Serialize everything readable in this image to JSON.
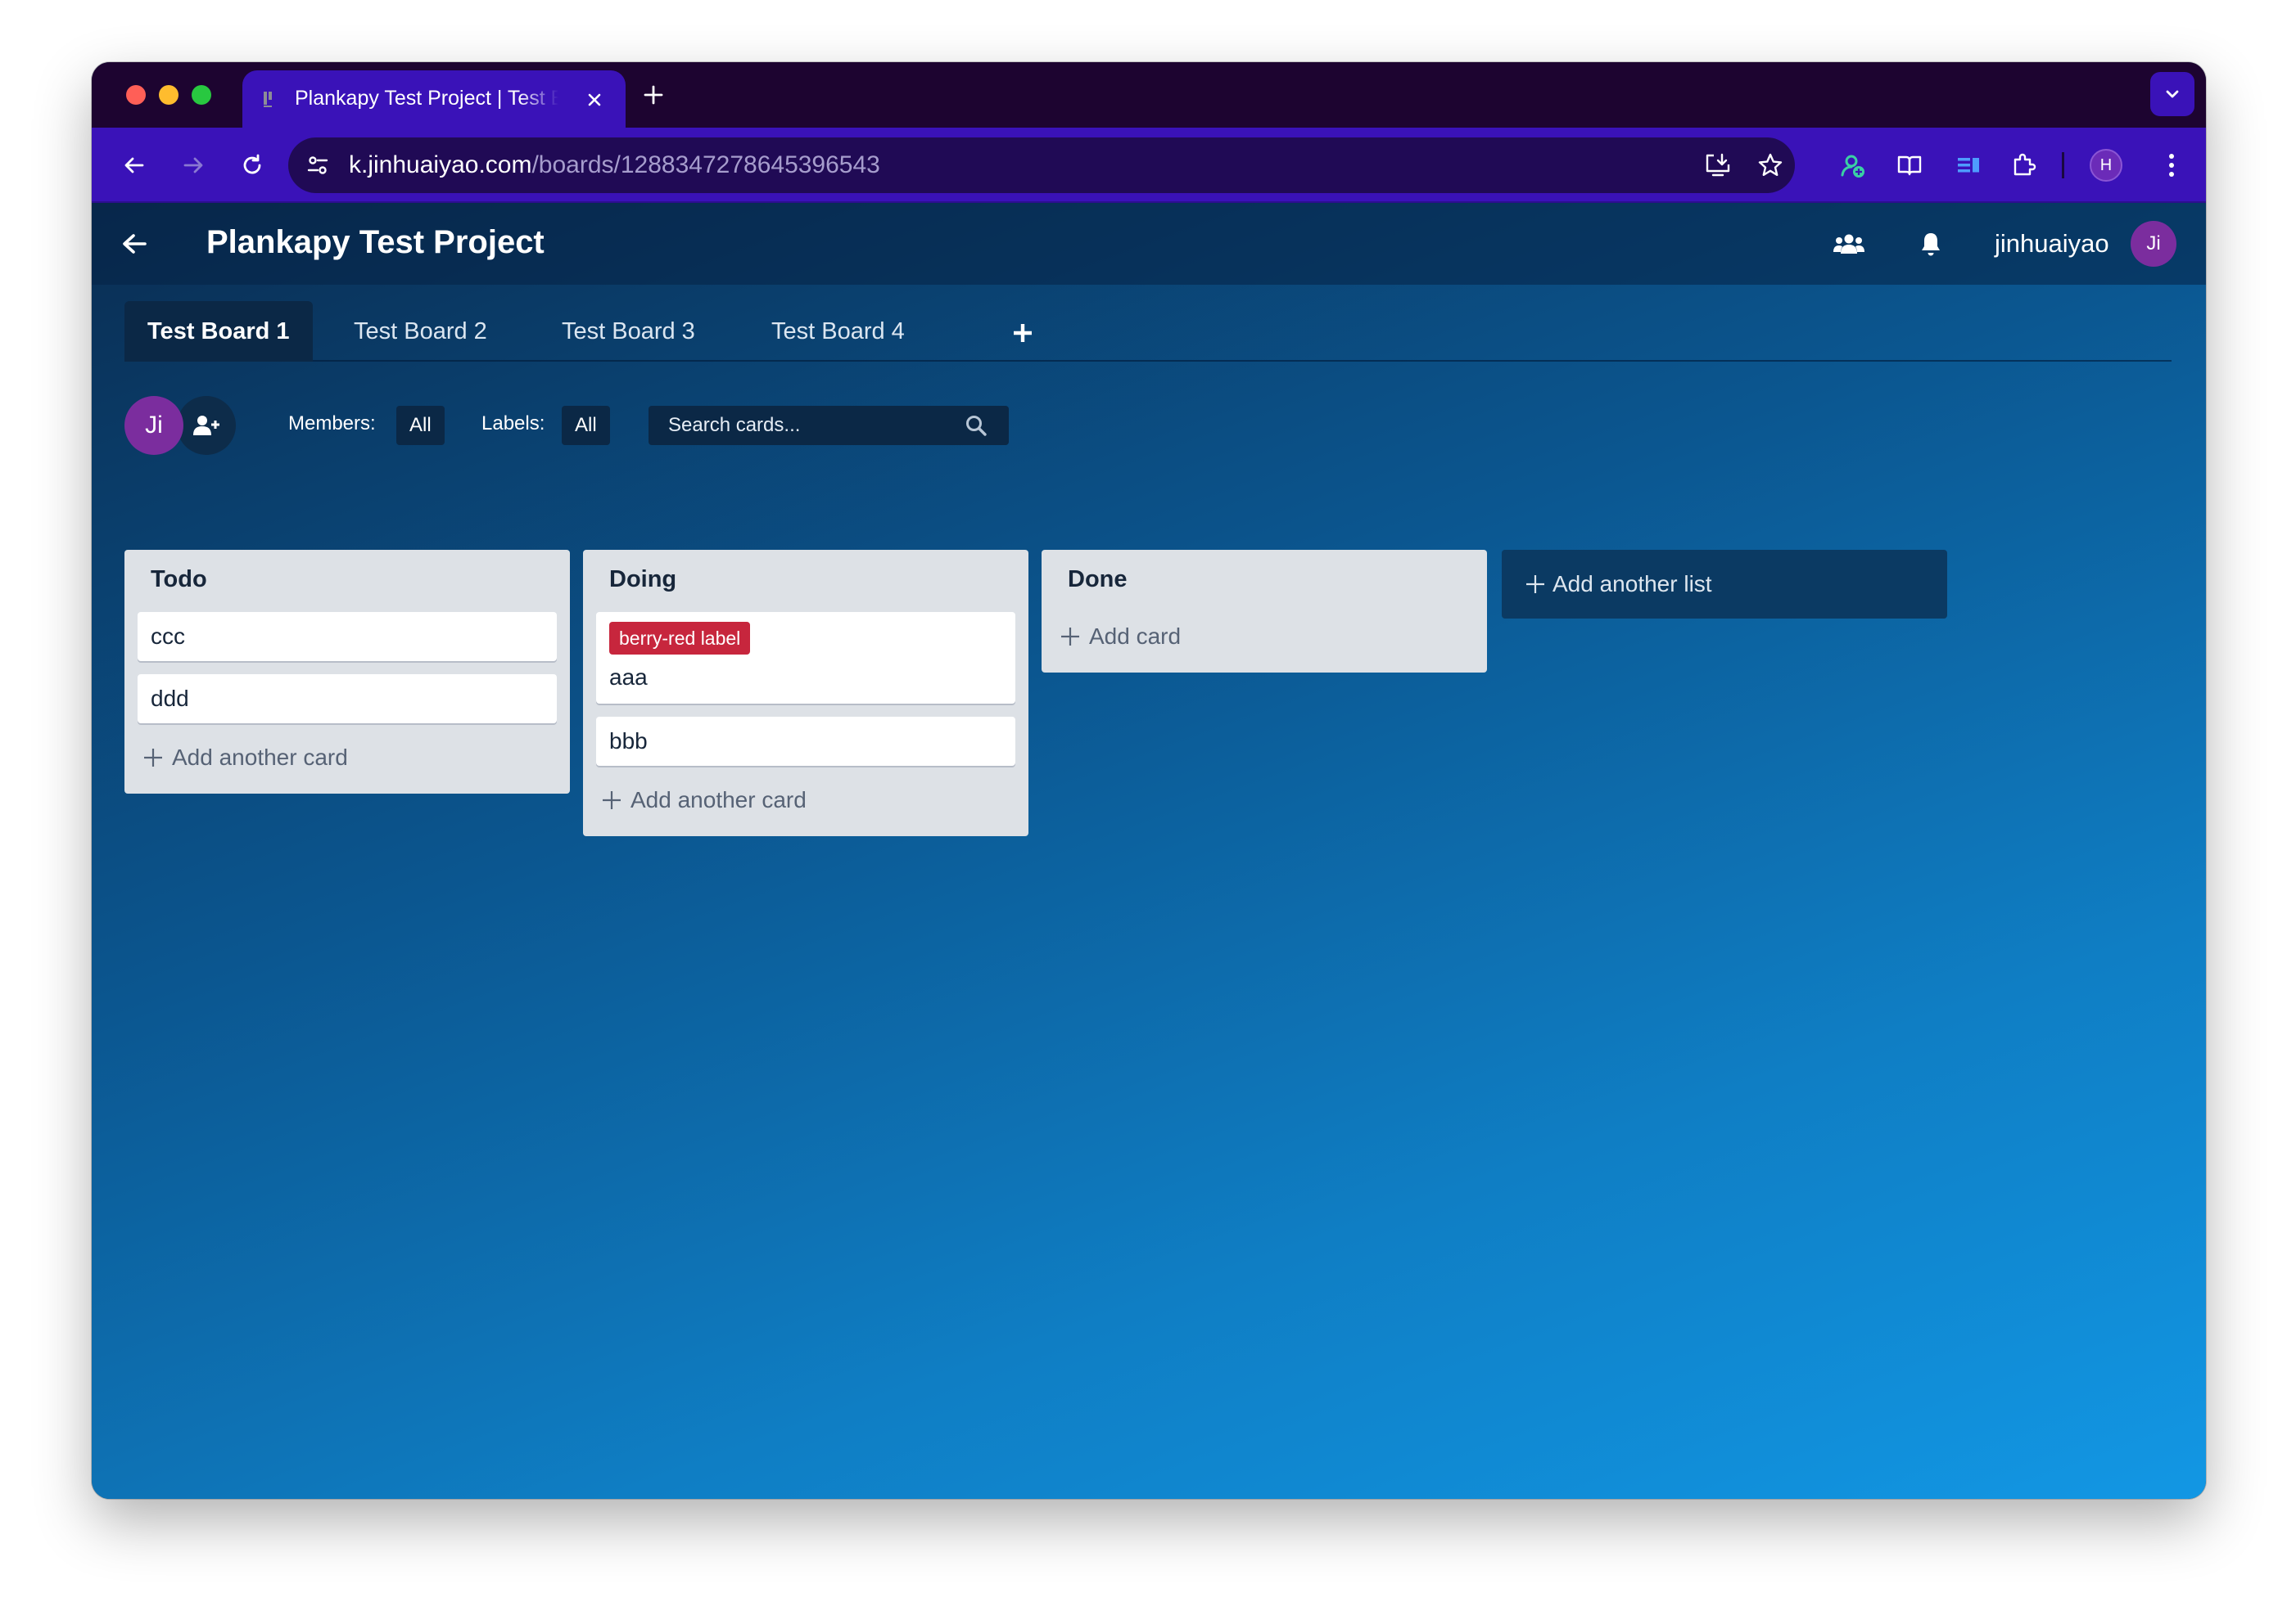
{
  "browser": {
    "tab": {
      "title": "Plankapy Test Project | Test Board 1"
    },
    "address_bar": {
      "host": "k.jinhuaiyao.com",
      "path": "/boards/1288347278645396543"
    },
    "profile_initial": "H"
  },
  "app": {
    "project_title": "Plankapy Test Project",
    "user": {
      "name": "jinhuaiyao",
      "initials": "Ji"
    },
    "boards": [
      {
        "label": "Test Board 1",
        "active": true
      },
      {
        "label": "Test Board 2",
        "active": false
      },
      {
        "label": "Test Board 3",
        "active": false
      },
      {
        "label": "Test Board 4",
        "active": false
      }
    ],
    "filters": {
      "members_label": "Members:",
      "members_value": "All",
      "labels_label": "Labels:",
      "labels_value": "All",
      "search_placeholder": "Search cards..."
    },
    "lists": [
      {
        "title": "Todo",
        "cards": [
          {
            "text": "ccc"
          },
          {
            "text": "ddd"
          }
        ],
        "add_label": "Add another card"
      },
      {
        "title": "Doing",
        "cards": [
          {
            "text": "aaa",
            "label": {
              "name": "berry-red label",
              "color": "#c7263d"
            }
          },
          {
            "text": "bbb"
          }
        ],
        "add_label": "Add another card"
      },
      {
        "title": "Done",
        "cards": [],
        "add_label": "Add card"
      }
    ],
    "add_list_label": "Add another list"
  },
  "colors": {
    "browser_frame": "#3a12b8",
    "tab_strip": "#1d0430",
    "avatar": "#7b2d9e",
    "label_berry_red": "#c7263d",
    "list_bg": "#dde1e6"
  }
}
